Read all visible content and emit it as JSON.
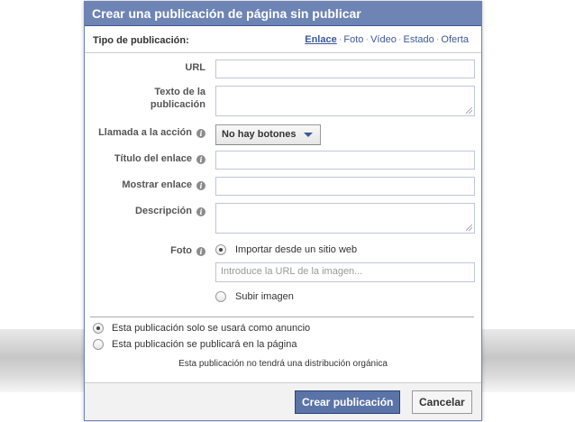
{
  "dialog": {
    "title": "Crear una publicación de página sin publicar",
    "type_label": "Tipo de publicación:",
    "type_links": [
      "Enlace",
      "Foto",
      "Vídeo",
      "Estado",
      "Oferta"
    ],
    "type_separator": "·",
    "selected_type": "Enlace"
  },
  "form": {
    "url_label": "URL",
    "text_label_line1": "Texto de la",
    "text_label_line2": "publicación",
    "cta_label": "Llamada a la acción",
    "cta_value": "No hay botones",
    "link_title_label": "Título del enlace",
    "display_link_label": "Mostrar enlace",
    "description_label": "Descripción",
    "photo_label": "Foto",
    "import_option": "Importar desde un sitio web",
    "image_url_placeholder": "Introduce la URL de la imagen...",
    "upload_option": "Subir imagen",
    "info_glyph": "i"
  },
  "audience": {
    "ad_only": "Esta publicación solo se usará como anuncio",
    "publish_page": "Esta publicación se publicará en la página",
    "note": "Esta publicación no tendrá una distribución orgánica"
  },
  "footer": {
    "create_label": "Crear publicación",
    "cancel_label": "Cancelar"
  },
  "colors": {
    "title_bar": "#6d84b4",
    "link": "#3b5998",
    "primary_button": "#5b74a8"
  }
}
